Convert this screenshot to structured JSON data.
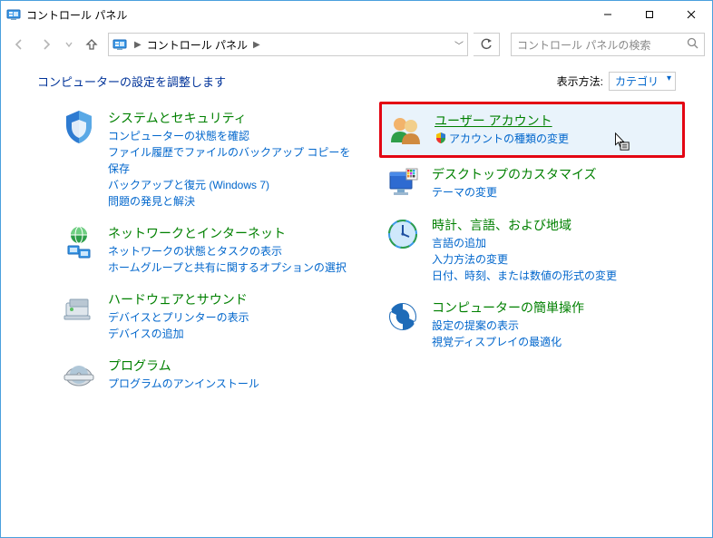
{
  "window_title": "コントロール パネル",
  "breadcrumb": {
    "root": "コントロール パネル"
  },
  "search_placeholder": "コントロール パネルの検索",
  "heading": "コンピューターの設定を調整します",
  "viewby": {
    "label": "表示方法:",
    "value": "カテゴリ"
  },
  "categories_left": [
    {
      "id": "system-security",
      "title": "システムとセキュリティ",
      "links": [
        "コンピューターの状態を確認",
        "ファイル履歴でファイルのバックアップ コピーを保存",
        "バックアップと復元 (Windows 7)",
        "問題の発見と解決"
      ]
    },
    {
      "id": "network-internet",
      "title": "ネットワークとインターネット",
      "links": [
        "ネットワークの状態とタスクの表示",
        "ホームグループと共有に関するオプションの選択"
      ]
    },
    {
      "id": "hardware-sound",
      "title": "ハードウェアとサウンド",
      "links": [
        "デバイスとプリンターの表示",
        "デバイスの追加"
      ]
    },
    {
      "id": "programs",
      "title": "プログラム",
      "links": [
        "プログラムのアンインストール"
      ]
    }
  ],
  "categories_right": [
    {
      "id": "user-accounts",
      "title": "ユーザー アカウント",
      "links": [
        "アカウントの種類の変更"
      ],
      "highlighted": true,
      "shield_on_first": true
    },
    {
      "id": "appearance",
      "title": "デスクトップのカスタマイズ",
      "links": [
        "テーマの変更"
      ]
    },
    {
      "id": "clock-lang-region",
      "title": "時計、言語、および地域",
      "links": [
        "言語の追加",
        "入力方法の変更",
        "日付、時刻、または数値の形式の変更"
      ]
    },
    {
      "id": "ease-of-access",
      "title": "コンピューターの簡単操作",
      "links": [
        "設定の提案の表示",
        "視覚ディスプレイの最適化"
      ]
    }
  ]
}
